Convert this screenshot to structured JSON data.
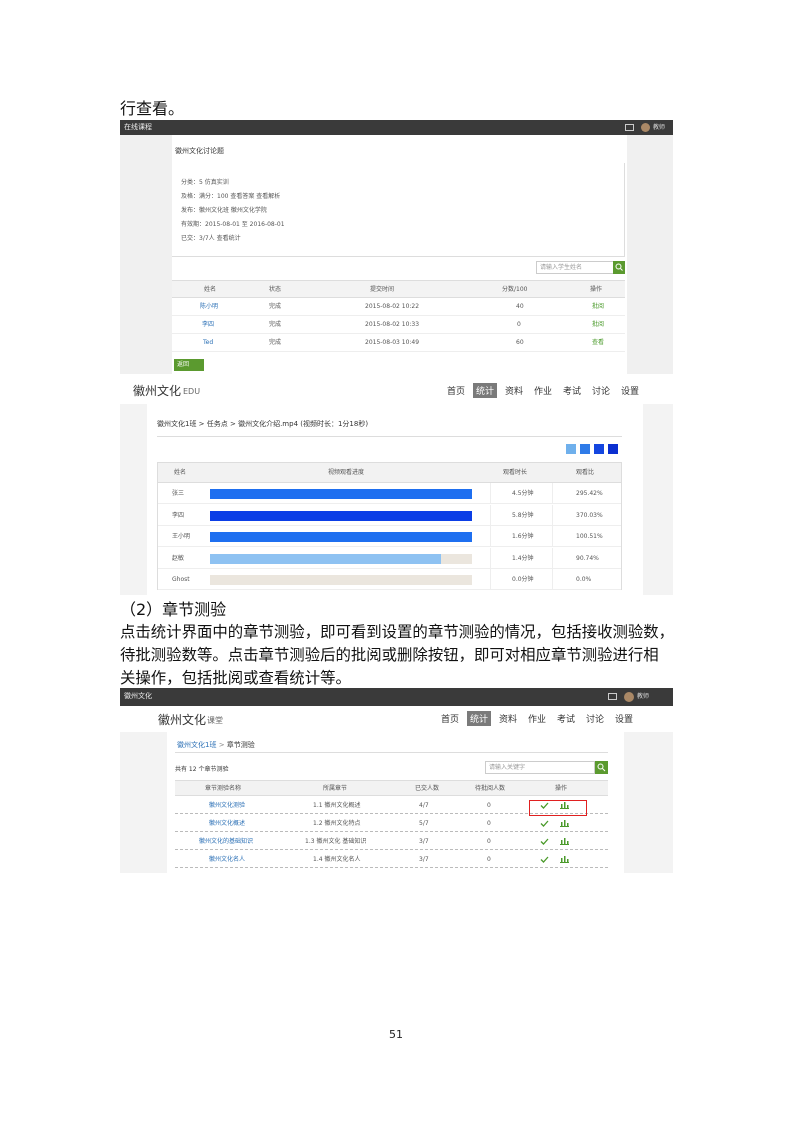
{
  "doc": {
    "intro_text": "行查看。",
    "section_title": "（2）章节测验",
    "para_line1": "点击统计界面中的章节测验，即可看到设置的章节测验的情况，包括接收测验数，",
    "para_line2": "待批测验数等。点击章节测验后的批阅或删除按钮，即可对相应章节测验进行相",
    "para_line3": "关操作，包括批阅或查看统计等。",
    "page_number": "51"
  },
  "shot1": {
    "topbar_title": "在线课程",
    "user_name": "教师",
    "card_title": "徽州文化讨论题",
    "info_lines": [
      "分类：5  仿真实训",
      "及格：满分：100  查看答案  查看解析",
      "发布：徽州文化班  徽州文化学院",
      "有效期：2015-08-01 至 2016-08-01",
      "已交：3/7人  查看统计"
    ],
    "search_placeholder": "请输入学生姓名",
    "table_headers": [
      "姓名",
      "状态",
      "提交时间",
      "分数/100",
      "操作"
    ],
    "rows": [
      {
        "name": "陈小明",
        "status": "完成",
        "time": "2015-08-02 10:22",
        "score": "40",
        "op": "批阅"
      },
      {
        "name": "李四",
        "status": "完成",
        "time": "2015-08-02 10:33",
        "score": "0",
        "op": "批阅"
      },
      {
        "name": "Ted",
        "status": "完成",
        "time": "2015-08-03 10:49",
        "score": "60",
        "op": "查看"
      }
    ],
    "back_button": "返回"
  },
  "shot2": {
    "logo": "徽州文化",
    "logo_suffix": "EDU",
    "nav": [
      "首页",
      "统计",
      "资料",
      "作业",
      "考试",
      "讨论",
      "设置"
    ],
    "nav_active": 1,
    "breadcrumb": "徽州文化1班 > 任务点 > 徽州文化介绍.mp4 (视频时长：1分18秒)",
    "legend_colors": [
      "#6fb0ec",
      "#2f7be8",
      "#1446e0",
      "#0b2fd0"
    ],
    "table_headers": [
      "姓名",
      "视频观看进度",
      "观看时长",
      "观看比"
    ],
    "rows": [
      {
        "name": "张三",
        "progress": 1.0,
        "color": "#1e6ff0",
        "duration": "4.5分钟",
        "ratio": "295.42%"
      },
      {
        "name": "李四",
        "progress": 1.0,
        "color": "#0b3ee6",
        "duration": "5.8分钟",
        "ratio": "370.03%"
      },
      {
        "name": "王小明",
        "progress": 1.0,
        "color": "#1e6ff0",
        "duration": "1.6分钟",
        "ratio": "100.51%"
      },
      {
        "name": "赵敏",
        "progress": 0.88,
        "color": "#8ec2f2",
        "duration": "1.4分钟",
        "ratio": "90.74%"
      },
      {
        "name": "Ghost",
        "progress": 0.0,
        "color": "#8ec2f2",
        "duration": "0.0分钟",
        "ratio": "0.0%"
      }
    ]
  },
  "shot3": {
    "topbar_title": "徽州文化",
    "user_name": "教师",
    "logo": "徽州文化",
    "logo_suffix": "课堂",
    "nav": [
      "首页",
      "统计",
      "资料",
      "作业",
      "考试",
      "讨论",
      "设置"
    ],
    "nav_active": 1,
    "breadcrumb_home": "徽州文化1班",
    "breadcrumb_current": "章节测验",
    "count_text": "共有 12 个章节测验",
    "search_placeholder": "请输入关键字",
    "table_headers": [
      "章节测验名称",
      "所属章节",
      "已交人数",
      "待批阅人数",
      "操作"
    ],
    "rows": [
      {
        "name": "徽州文化测验",
        "chapter": "1.1 徽州文化概述",
        "submitted": "4/7",
        "pending": "0"
      },
      {
        "name": "徽州文化概述",
        "chapter": "1.2 徽州文化特点",
        "submitted": "5/7",
        "pending": "0"
      },
      {
        "name": "徽州文化的基础知识",
        "chapter": "1.3 徽州文化 基础知识",
        "submitted": "3/7",
        "pending": "0"
      },
      {
        "name": "徽州文化名人",
        "chapter": "1.4 徽州文化名人",
        "submitted": "3/7",
        "pending": "0"
      }
    ]
  }
}
